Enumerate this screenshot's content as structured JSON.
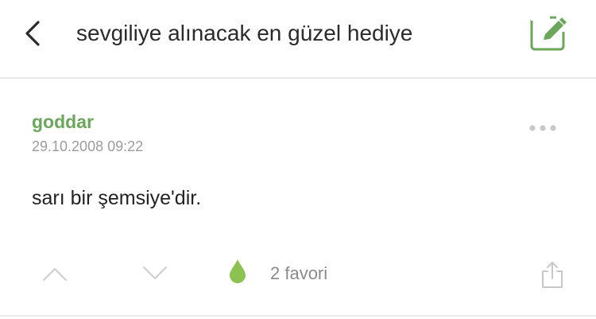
{
  "header": {
    "title": "sevgiliye alınacak en güzel hediye",
    "back_icon": "chevron-left-icon",
    "compose_icon": "edit-icon"
  },
  "entry": {
    "author": "goddar",
    "date": "29.10.2008 09:22",
    "content": "sarı bir şemsiye'dir.",
    "more_icon": "more-dots-icon"
  },
  "actions": {
    "upvote_icon": "chevron-up-icon",
    "downvote_icon": "chevron-down-icon",
    "favorite_icon": "drop-icon",
    "favorites_label": "2 favori",
    "share_icon": "share-icon"
  },
  "colors": {
    "accent": "#6aa75b",
    "muted": "#9c9c9c",
    "text": "#222222"
  }
}
